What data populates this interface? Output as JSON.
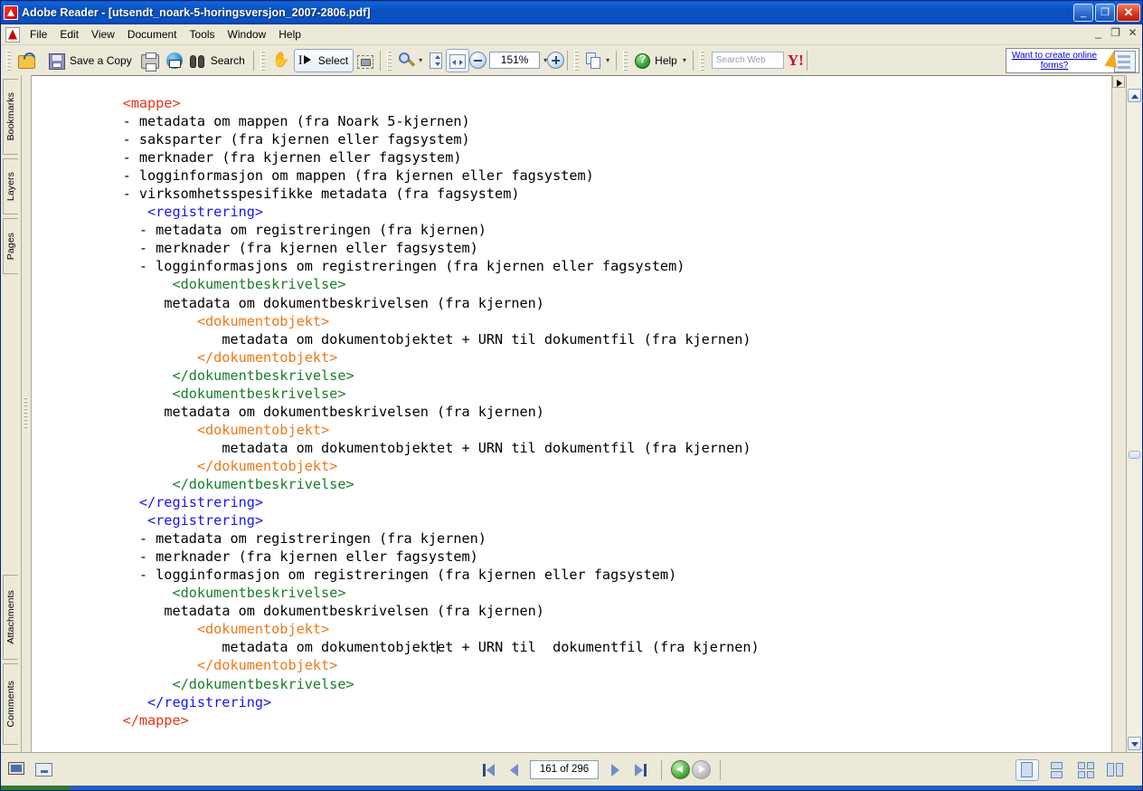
{
  "window": {
    "title": "Adobe Reader - [utsendt_noark-5-horingsversjon_2007-2806.pdf]",
    "minimize": "_",
    "maximize": "❐",
    "close": "✕",
    "mdi_minimize": "_",
    "mdi_restore": "❐",
    "mdi_close": "✕"
  },
  "menu": {
    "items": [
      {
        "label": "File"
      },
      {
        "label": "Edit"
      },
      {
        "label": "View"
      },
      {
        "label": "Document"
      },
      {
        "label": "Tools"
      },
      {
        "label": "Window"
      },
      {
        "label": "Help"
      }
    ]
  },
  "toolbar": {
    "open_label": "",
    "save_copy_label": "Save a Copy",
    "print_label": "",
    "email_label": "",
    "search_label": "Search",
    "hand_label": "",
    "select_label": "Select",
    "snapshot_label": "",
    "zoom_label": "",
    "fit_page_label": "",
    "fit_width_label": "",
    "zoom_out_label": "",
    "zoom_value": "151%",
    "zoom_in_label": "",
    "pages_label": "",
    "help_label": "Help",
    "search_web_placeholder": "Search Web",
    "yahoo_label": "Y!",
    "dropdown_caret": "▾"
  },
  "banner": {
    "line1": "Want to create online",
    "line2": "forms?"
  },
  "navpane": {
    "tabs": [
      {
        "label": "Bookmarks"
      },
      {
        "label": "Layers"
      },
      {
        "label": "Pages"
      },
      {
        "label": "Attachments"
      },
      {
        "label": "Comments"
      }
    ]
  },
  "document": {
    "lines": [
      {
        "indent": 0,
        "segments": [
          {
            "text": "<mappe>",
            "color": "red"
          }
        ]
      },
      {
        "indent": 0,
        "segments": [
          {
            "text": "- metadata om mappen (fra Noark 5-kjernen)",
            "color": "black"
          }
        ]
      },
      {
        "indent": 0,
        "segments": [
          {
            "text": "- saksparter (fra kjernen eller fagsystem)",
            "color": "black"
          }
        ]
      },
      {
        "indent": 0,
        "segments": [
          {
            "text": "- merknader (fra kjernen eller fagsystem)",
            "color": "black"
          }
        ]
      },
      {
        "indent": 0,
        "segments": [
          {
            "text": "- logginformasjon om mappen (fra kjernen eller fagsystem)",
            "color": "black"
          }
        ]
      },
      {
        "indent": 0,
        "segments": [
          {
            "text": "- virksomhetsspesifikke metadata (fra fagsystem)",
            "color": "black"
          }
        ]
      },
      {
        "indent": 3,
        "segments": [
          {
            "text": "<registrering>",
            "color": "blue"
          }
        ]
      },
      {
        "indent": 2,
        "segments": [
          {
            "text": "- metadata om registreringen (fra kjernen)",
            "color": "black"
          }
        ]
      },
      {
        "indent": 2,
        "segments": [
          {
            "text": "- merknader (fra kjernen eller fagsystem)",
            "color": "black"
          }
        ]
      },
      {
        "indent": 2,
        "segments": [
          {
            "text": "- logginformasjons om registreringen (fra kjernen eller fagsystem)",
            "color": "black"
          }
        ]
      },
      {
        "indent": 6,
        "segments": [
          {
            "text": "<dokumentbeskrivelse>",
            "color": "green"
          }
        ]
      },
      {
        "indent": 5,
        "segments": [
          {
            "text": "metadata om dokumentbeskrivelsen (fra kjernen)",
            "color": "black"
          }
        ]
      },
      {
        "indent": 9,
        "segments": [
          {
            "text": "<dokumentobjekt>",
            "color": "orange"
          }
        ]
      },
      {
        "indent": 12,
        "segments": [
          {
            "text": "metadata om dokumentobjektet + URN til dokumentfil (fra kjernen)",
            "color": "black"
          }
        ]
      },
      {
        "indent": 9,
        "segments": [
          {
            "text": "</dokumentobjekt>",
            "color": "orange"
          }
        ]
      },
      {
        "indent": 6,
        "segments": [
          {
            "text": "</dokumentbeskrivelse>",
            "color": "green"
          }
        ]
      },
      {
        "indent": 6,
        "segments": [
          {
            "text": "<dokumentbeskrivelse>",
            "color": "green"
          }
        ]
      },
      {
        "indent": 5,
        "segments": [
          {
            "text": "metadata om dokumentbeskrivelsen (fra kjernen)",
            "color": "black"
          }
        ]
      },
      {
        "indent": 9,
        "segments": [
          {
            "text": "<dokumentobjekt>",
            "color": "orange"
          }
        ]
      },
      {
        "indent": 12,
        "segments": [
          {
            "text": "metadata om dokumentobjektet + URN til dokumentfil (fra kjernen)",
            "color": "black"
          }
        ]
      },
      {
        "indent": 9,
        "segments": [
          {
            "text": "</dokumentobjekt>",
            "color": "orange"
          }
        ]
      },
      {
        "indent": 6,
        "segments": [
          {
            "text": "</dokumentbeskrivelse>",
            "color": "green"
          }
        ]
      },
      {
        "indent": 2,
        "segments": [
          {
            "text": "</registrering>",
            "color": "blue"
          }
        ]
      },
      {
        "indent": 3,
        "segments": [
          {
            "text": "<registrering>",
            "color": "blue"
          }
        ]
      },
      {
        "indent": 2,
        "segments": [
          {
            "text": "- metadata om registreringen (fra kjernen)",
            "color": "black"
          }
        ]
      },
      {
        "indent": 2,
        "segments": [
          {
            "text": "- merknader (fra kjernen eller fagsystem)",
            "color": "black"
          }
        ]
      },
      {
        "indent": 2,
        "segments": [
          {
            "text": "- logginformasjon om registreringen (fra kjernen eller fagsystem)",
            "color": "black"
          }
        ]
      },
      {
        "indent": 6,
        "segments": [
          {
            "text": "<dokumentbeskrivelse>",
            "color": "green"
          }
        ]
      },
      {
        "indent": 5,
        "segments": [
          {
            "text": "metadata om dokumentbeskrivelsen (fra kjernen)",
            "color": "black"
          }
        ]
      },
      {
        "indent": 9,
        "segments": [
          {
            "text": "<dokumentobjekt>",
            "color": "orange"
          }
        ]
      },
      {
        "indent": 12,
        "segments": [
          {
            "text": "metadata om dokumentobjekt",
            "color": "black"
          },
          {
            "text": "|",
            "color": "caret"
          },
          {
            "text": "et + URN til  dokumentfil (fra kjernen)",
            "color": "black"
          }
        ]
      },
      {
        "indent": 9,
        "segments": [
          {
            "text": "</dokumentobjekt>",
            "color": "orange"
          }
        ]
      },
      {
        "indent": 6,
        "segments": [
          {
            "text": "</dokumentbeskrivelse>",
            "color": "green"
          }
        ]
      },
      {
        "indent": 3,
        "segments": [
          {
            "text": "</registrering>",
            "color": "blue"
          }
        ]
      },
      {
        "indent": 0,
        "segments": [
          {
            "text": "</mappe>",
            "color": "red"
          }
        ]
      }
    ],
    "colors": {
      "red": "#e8361b",
      "blue": "#1717e8",
      "green": "#1a7d2a",
      "orange": "#f07818",
      "black": "#000000"
    }
  },
  "statusbar": {
    "first_page_label": "",
    "prev_page_label": "",
    "page_value": "161 of 296",
    "next_page_label": "",
    "last_page_label": "",
    "previous_view_label": "",
    "next_view_label": "",
    "view_single_label": "",
    "view_continuous_label": "",
    "view_facing_label": "",
    "view_continuous_facing_label": ""
  }
}
